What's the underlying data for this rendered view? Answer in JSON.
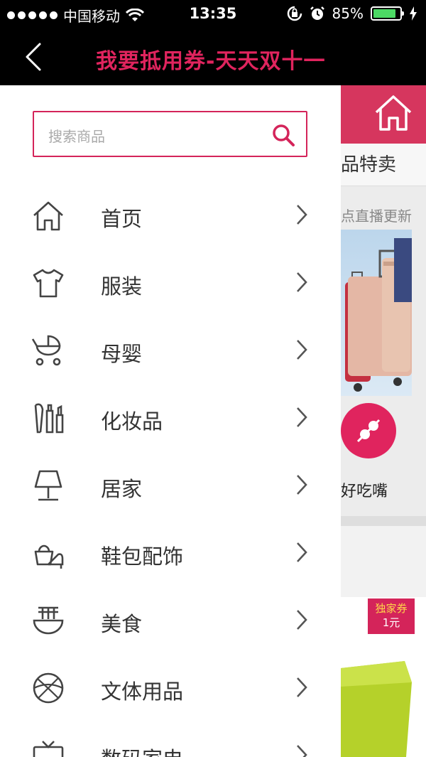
{
  "status_bar": {
    "carrier": "中国移动",
    "time": "13:35",
    "battery": "85%",
    "battery_level": 0.85,
    "icons": [
      "signal-dots-icon",
      "wifi-icon",
      "rotation-lock-icon",
      "alarm-icon",
      "battery-icon",
      "charging-icon"
    ]
  },
  "nav": {
    "title": "我要抵用券-天天双十一",
    "back_icon": "chevron-left-icon"
  },
  "search": {
    "placeholder": "搜索商品",
    "icon": "search-icon"
  },
  "menu": [
    {
      "label": "首页",
      "icon": "home-icon"
    },
    {
      "label": "服装",
      "icon": "tshirt-icon"
    },
    {
      "label": "母婴",
      "icon": "stroller-icon"
    },
    {
      "label": "化妆品",
      "icon": "cosmetics-icon"
    },
    {
      "label": "居家",
      "icon": "lamp-icon"
    },
    {
      "label": "鞋包配饰",
      "icon": "shoe-bag-icon"
    },
    {
      "label": "美食",
      "icon": "food-bowl-icon"
    },
    {
      "label": "文体用品",
      "icon": "ball-icon"
    },
    {
      "label": "数码家电",
      "icon": "tv-icon"
    }
  ],
  "background_page": {
    "tab_text": "品特卖",
    "live_text": "点直播更新",
    "circle_label": "好吃嘴",
    "badge_title": "独家券",
    "badge_value": "1元"
  },
  "colors": {
    "accent": "#d4245a",
    "nav_title": "#e0245e",
    "battery": "#4cd964"
  }
}
